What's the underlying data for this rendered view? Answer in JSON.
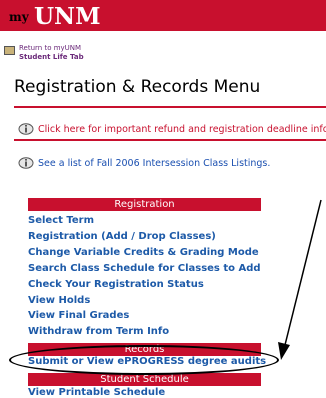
{
  "banner": {
    "prefix": "my",
    "brand": "UNM",
    "brand_color": "#c8102e"
  },
  "return_link": {
    "line1": "Return to myUNM",
    "line2": "Student Life Tab"
  },
  "page_title": "Registration & Records Menu",
  "notices": [
    {
      "text": "Click here for important refund and registration deadline inform"
    },
    {
      "text": "See a list of Fall 2006 Intersession Class Listings."
    }
  ],
  "sections": {
    "registration": "Registration",
    "records": "Records",
    "student_schedule": "Student Schedule"
  },
  "registration_links": [
    "Select Term",
    "Registration (Add / Drop Classes)",
    "Change Variable Credits & Grading Mode",
    "Search Class Schedule for Classes to Add",
    "Check Your Registration Status",
    "View Holds",
    "View Final Grades",
    "Withdraw from Term Info"
  ],
  "records_links": [
    "Submit or View ePROGRESS degree audits"
  ],
  "schedule_links": [
    "View Printable Schedule"
  ]
}
